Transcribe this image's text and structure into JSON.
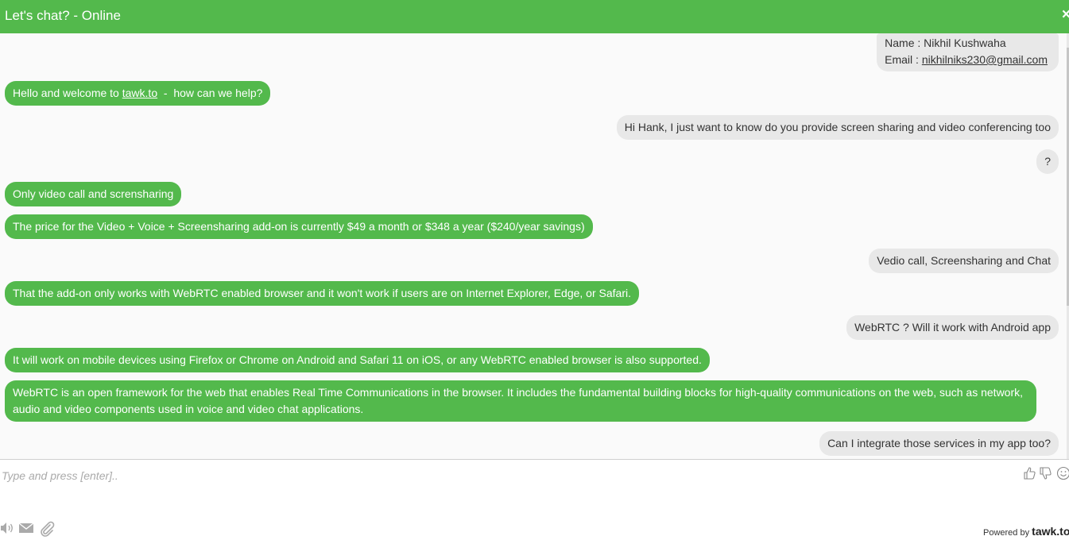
{
  "header": {
    "title": "Let's chat? - Online",
    "close_label": "×"
  },
  "visitor_info": {
    "name_label": "Name : ",
    "name": "Nikhil Kushwaha",
    "email_label": "Email : ",
    "email": "nikhilniks230@gmail.com"
  },
  "welcome": {
    "prefix": "Hello and welcome to ",
    "link": "tawk.to",
    "suffix": "  -  how can we help?"
  },
  "messages": [
    {
      "from": "visitor",
      "text": "Hi Hank, I just want to know do you provide screen sharing and video conferencing too"
    },
    {
      "from": "visitor",
      "text": "?"
    },
    {
      "from": "agent",
      "text": "Only video call and scrensharing"
    },
    {
      "from": "agent",
      "text": "The price for the Video + Voice + Screensharing add-on is currently $49 a month or $348 a year ($240/year savings)"
    },
    {
      "from": "visitor",
      "text": "Vedio call, Screensharing and Chat"
    },
    {
      "from": "agent",
      "text": "That the add-on only works with WebRTC enabled browser and it won't work if users are on Internet Explorer, Edge, or Safari."
    },
    {
      "from": "visitor",
      "text": "WebRTC ? Will it work with Android app"
    },
    {
      "from": "agent",
      "text": "It will work on mobile devices using Firefox or Chrome on Android and Safari 11 on iOS, or any WebRTC enabled browser is also supported."
    },
    {
      "from": "agent",
      "text": "WebRTC is an open framework for the web that enables Real Time Communications in the browser. It includes the fundamental building blocks for high-quality communications on the web, such as network, audio and video components used in voice and video chat applications."
    },
    {
      "from": "visitor",
      "text": "Can I integrate those services in my app too?"
    }
  ],
  "composer": {
    "placeholder": "Type and press [enter].."
  },
  "footer": {
    "powered_label": "Powered by ",
    "brand": "tawk.to"
  },
  "icons": [
    "thumbs-up-icon",
    "thumbs-down-icon",
    "emoji-icon",
    "sound-icon",
    "email-icon",
    "attachment-icon",
    "close-icon"
  ],
  "colors": {
    "accent": "#53b94c",
    "visitor_bubble": "#e8e8e8",
    "chat_background": "#fafafa"
  }
}
